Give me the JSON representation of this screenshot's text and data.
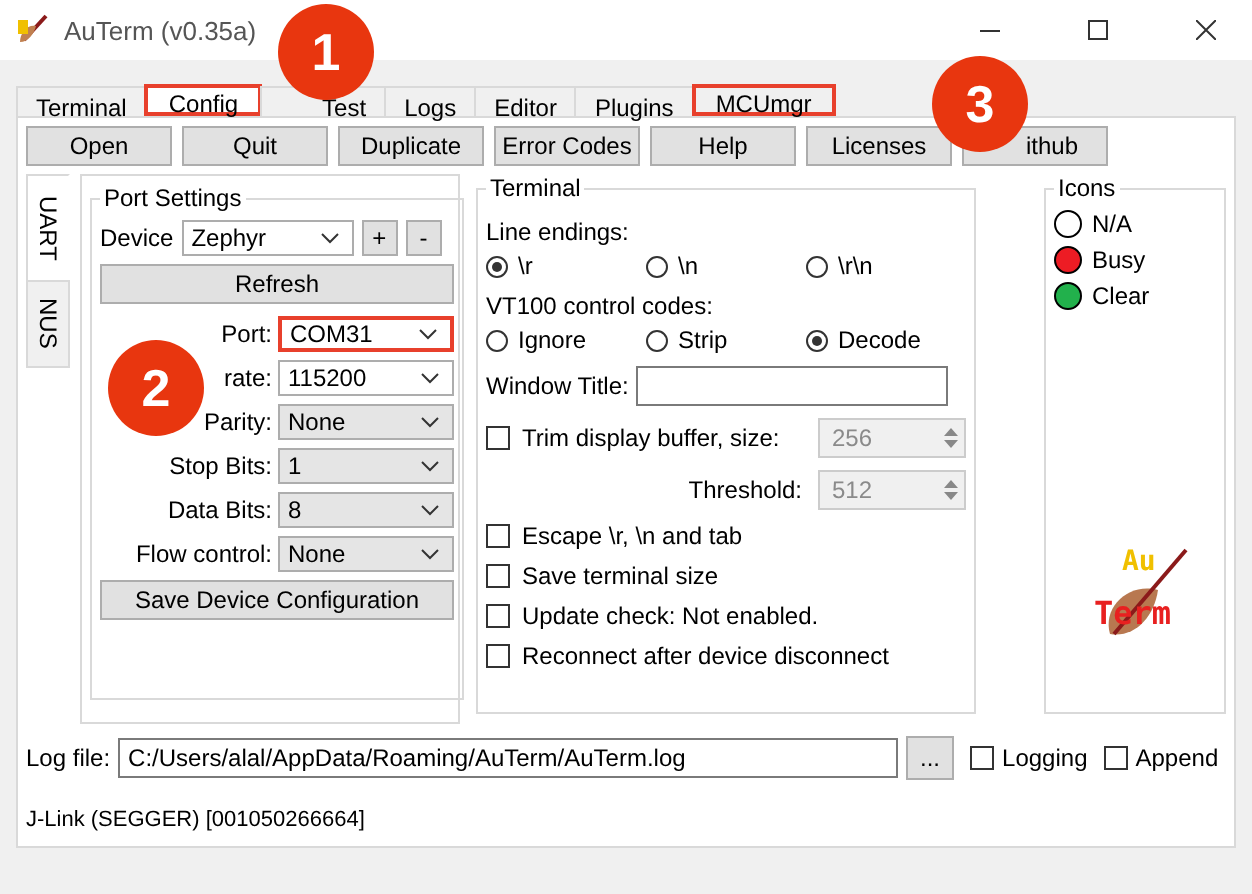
{
  "window": {
    "title": "AuTerm (v0.35a)"
  },
  "tabs": [
    {
      "label": "Terminal",
      "selected": false,
      "highlighted": false
    },
    {
      "label": "Config",
      "selected": true,
      "highlighted": true
    },
    {
      "label": "Test",
      "selected": false,
      "highlighted": false
    },
    {
      "label": "Logs",
      "selected": false,
      "highlighted": false
    },
    {
      "label": "Editor",
      "selected": false,
      "highlighted": false
    },
    {
      "label": "Plugins",
      "selected": false,
      "highlighted": false
    },
    {
      "label": "MCUmgr",
      "selected": false,
      "highlighted": true
    }
  ],
  "toolbar": [
    "Open",
    "Quit",
    "Duplicate",
    "Error Codes",
    "Help",
    "Licenses",
    "ithub"
  ],
  "side_tabs": [
    {
      "label": "UART",
      "selected": true
    },
    {
      "label": "NUS",
      "selected": false
    }
  ],
  "port_settings": {
    "title": "Port Settings",
    "device": {
      "label": "Device",
      "value": "Zephyr",
      "add": "+",
      "remove": "-"
    },
    "refresh": "Refresh",
    "fields": [
      {
        "label": "Port:",
        "value": "COM31",
        "highlighted": true
      },
      {
        "label": "rate:",
        "value": "115200",
        "highlighted": false
      },
      {
        "label": "Parity:",
        "value": "None",
        "highlighted": false
      },
      {
        "label": "Stop Bits:",
        "value": "1",
        "highlighted": false
      },
      {
        "label": "Data Bits:",
        "value": "8",
        "highlighted": false
      },
      {
        "label": "Flow control:",
        "value": "None",
        "highlighted": false
      }
    ],
    "save": "Save Device Configuration"
  },
  "terminal": {
    "title": "Terminal",
    "line_endings": {
      "label": "Line endings:",
      "options": [
        {
          "label": "\\r",
          "selected": true
        },
        {
          "label": "\\n",
          "selected": false
        },
        {
          "label": "\\r\\n",
          "selected": false
        }
      ]
    },
    "vt100": {
      "label": "VT100 control codes:",
      "options": [
        {
          "label": "Ignore",
          "selected": false
        },
        {
          "label": "Strip",
          "selected": false
        },
        {
          "label": "Decode",
          "selected": true
        }
      ]
    },
    "window_title": {
      "label": "Window Title:"
    },
    "trim": {
      "label": "Trim display buffer, size:",
      "checked": false,
      "value": "256",
      "disabled": true
    },
    "threshold": {
      "label": "Threshold:",
      "value": "512",
      "disabled": true
    },
    "checks": [
      {
        "label": "Escape \\r, \\n and tab",
        "checked": false
      },
      {
        "label": "Save terminal size",
        "checked": false
      },
      {
        "label": "Update check: Not enabled.",
        "checked": false
      },
      {
        "label": "Reconnect after device disconnect",
        "checked": false
      }
    ]
  },
  "icons": {
    "title": "Icons",
    "items": [
      {
        "label": "N/A",
        "color": "#ffffff"
      },
      {
        "label": "Busy",
        "color": "#ed1c24"
      },
      {
        "label": "Clear",
        "color": "#22b14c"
      }
    ],
    "logo": {
      "top": "Au",
      "bottom": "Term"
    }
  },
  "log": {
    "label": "Log file:",
    "value": "C:/Users/alal/AppData/Roaming/AuTerm/AuTerm.log",
    "browse": "...",
    "options": [
      {
        "label": "Logging",
        "checked": false
      },
      {
        "label": "Append",
        "checked": false
      }
    ]
  },
  "status": "J-Link (SEGGER) [001050266664]",
  "callouts": [
    "1",
    "2",
    "3"
  ]
}
